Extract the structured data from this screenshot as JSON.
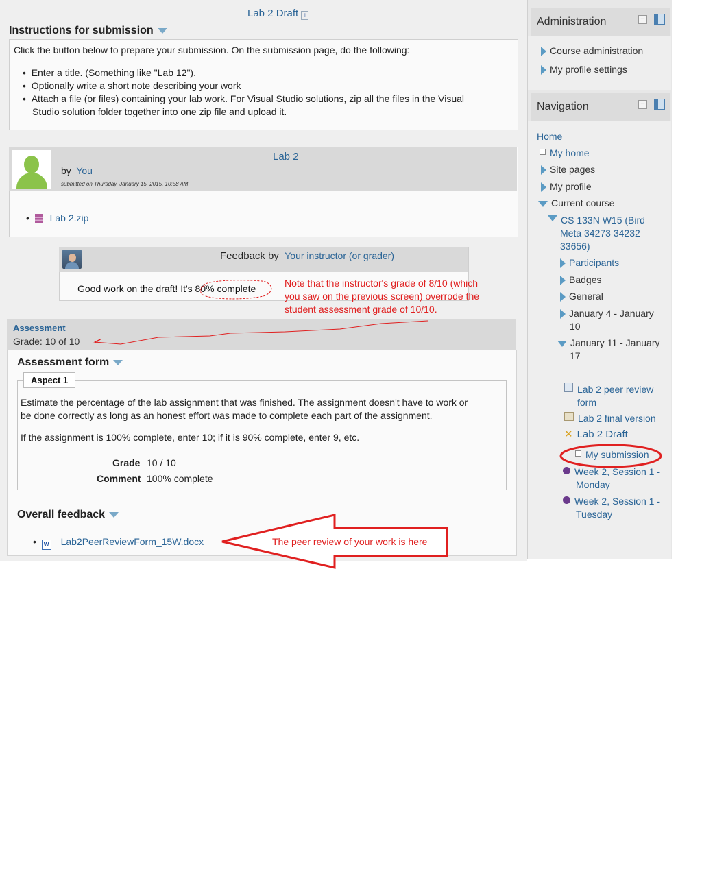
{
  "page_title": "Lab 2 Draft",
  "instructions": {
    "heading": "Instructions for submission",
    "intro": "Click the button below to prepare your submission. On the submission page, do the following:",
    "items": [
      "Enter a title. (Something like \"Lab 12\").",
      "Optionally write a short note describing your work",
      "Attach a file (or files) containing your lab work. For Visual Studio solutions, zip all the files in the Visual",
      "Studio solution folder together into one zip file and upload it."
    ]
  },
  "submission": {
    "title": "Lab 2",
    "by_label": "by",
    "author": "You",
    "submitted": "submitted on Thursday, January 15, 2015, 10:58 AM",
    "attachment": "Lab 2.zip"
  },
  "feedback": {
    "label": "Feedback by",
    "instructor": "Your instructor (or grader)",
    "text": "Good work on the draft! It's 80% complete"
  },
  "annotation_note": [
    "Note that the instructor's grade of 8/10 (which",
    "you saw on the previous screen) overrode the",
    "student assessment grade of 10/10."
  ],
  "assessment": {
    "title": "Assessment",
    "grade_line": "Grade: 10 of 10",
    "form_heading": "Assessment form",
    "aspect_label": "Aspect 1",
    "desc1": "Estimate the percentage of the lab assignment that was finished. The assignment doesn't have to work or",
    "desc1b": "be done correctly as long as an honest effort was made to complete each part of the assignment.",
    "desc2": "If the assignment is 100% complete, enter 10; if it is 90% complete, enter 9, etc.",
    "grade_label": "Grade",
    "grade_value": "10 / 10",
    "comment_label": "Comment",
    "comment_value": "100% complete"
  },
  "overall_feedback": {
    "heading": "Overall feedback",
    "file": "Lab2PeerReviewForm_15W.docx",
    "arrow_note": "The peer review of your work is here"
  },
  "admin_block": {
    "title": "Administration",
    "items": [
      "Course administration",
      "My profile settings"
    ]
  },
  "nav_block": {
    "title": "Navigation",
    "home": "Home",
    "my_home": "My home",
    "site_pages": "Site pages",
    "my_profile": "My profile",
    "current_course": "Current course",
    "course_name": [
      "CS 133N W15 (Bird",
      "Meta 34273 34232",
      "33656)"
    ],
    "participants": "Participants",
    "badges": "Badges",
    "general": "General",
    "week1": [
      "January 4 - January",
      "10"
    ],
    "week2": [
      "January 11 - January",
      "17"
    ],
    "activities": {
      "peer_review_form": [
        "Lab 2 peer review",
        "form"
      ],
      "final_version": "Lab 2 final version",
      "draft": "Lab 2 Draft",
      "my_submission": "My submission",
      "week2_mon": [
        "Week 2, Session 1 -",
        "Monday"
      ],
      "week2_tue": [
        "Week 2, Session 1 -",
        "Tuesday"
      ]
    }
  },
  "colors": {
    "annotation_red": "#e02020",
    "link_blue": "#2a6496"
  }
}
